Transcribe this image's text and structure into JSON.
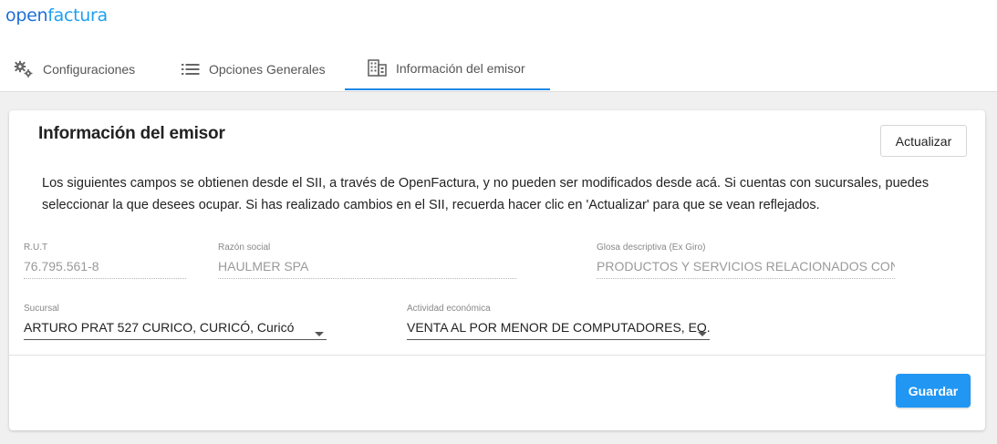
{
  "logo": {
    "part1": "open",
    "part2": "factura"
  },
  "tabs": [
    {
      "label": "Configuraciones",
      "icon": "gears-icon"
    },
    {
      "label": "Opciones Generales",
      "icon": "list-icon"
    },
    {
      "label": "Información del emisor",
      "icon": "building-icon",
      "active": true
    }
  ],
  "card": {
    "title": "Información del emisor",
    "update_button": "Actualizar",
    "description": "Los siguientes campos se obtienen desde el SII, a través de OpenFactura, y no pueden ser modificados desde acá. Si cuentas con sucursales, puedes seleccionar la que desees ocupar. Si has realizado cambios en el SII, recuerda hacer clic en 'Actualizar' para que se vean reflejados.",
    "fields": {
      "rut": {
        "label": "R.U.T",
        "value": "76.795.561-8"
      },
      "razon_social": {
        "label": "Razón social",
        "value": "HAULMER SPA"
      },
      "glosa": {
        "label": "Glosa descriptiva (Ex Giro)",
        "value": "PRODUCTOS Y SERVICIOS RELACIONADOS CON INT"
      },
      "sucursal": {
        "label": "Sucursal",
        "value": "ARTURO PRAT 527 CURICO, CURICÓ, Curicó"
      },
      "actividad": {
        "label": "Actividad económica",
        "value": "VENTA AL POR MENOR DE COMPUTADORES, EQ..."
      }
    },
    "save_button": "Guardar"
  },
  "colors": {
    "accent": "#1e88e5",
    "primary_button": "#2196f3",
    "logo_dark": "#1e6fd9",
    "logo_light": "#1ea0f0"
  }
}
